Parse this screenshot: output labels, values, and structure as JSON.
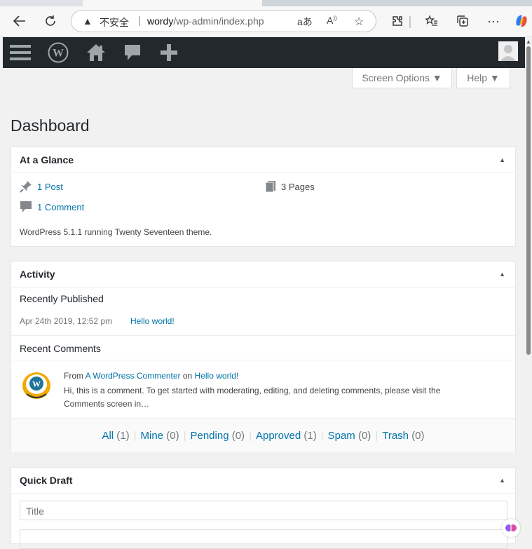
{
  "browser": {
    "insecure_label": "不安全",
    "url_host": "wordy",
    "url_path": "/wp-admin/index.php",
    "read_aloud": "aあ"
  },
  "admin_bar": {
    "items": [
      "menu-icon",
      "wordpress-logo-icon",
      "home-icon",
      "comment-icon",
      "plus-icon"
    ]
  },
  "screen_options": {
    "label": "Screen Options ▼"
  },
  "help": {
    "label": "Help ▼"
  },
  "page_title": "Dashboard",
  "at_a_glance": {
    "title": "At a Glance",
    "posts": "1 Post",
    "pages": "3 Pages",
    "comments": "1 Comment",
    "footer": "WordPress 5.1.1 running Twenty Seventeen theme."
  },
  "activity": {
    "title": "Activity",
    "recently_published": "Recently Published",
    "published_date": "Apr 24th 2019, 12:52 pm",
    "published_link": "Hello world!",
    "recent_comments": "Recent Comments",
    "comment_from": "From",
    "comment_author": "A WordPress Commenter",
    "comment_on": "on",
    "comment_post": "Hello world!",
    "comment_text_1": "Hi, this is a comment. To get started with moderating, editing, and deleting comments, please visit the",
    "comment_text_2": "Comments screen in…",
    "filters": [
      {
        "label": "All",
        "count": "(1)"
      },
      {
        "label": "Mine",
        "count": "(0)"
      },
      {
        "label": "Pending",
        "count": "(0)"
      },
      {
        "label": "Approved",
        "count": "(1)"
      },
      {
        "label": "Spam",
        "count": "(0)"
      },
      {
        "label": "Trash",
        "count": "(0)"
      }
    ]
  },
  "quick_draft": {
    "title": "Quick Draft",
    "title_placeholder": "Title"
  },
  "colors": {
    "admin_bar": "#23282d",
    "link": "#0073aa"
  }
}
